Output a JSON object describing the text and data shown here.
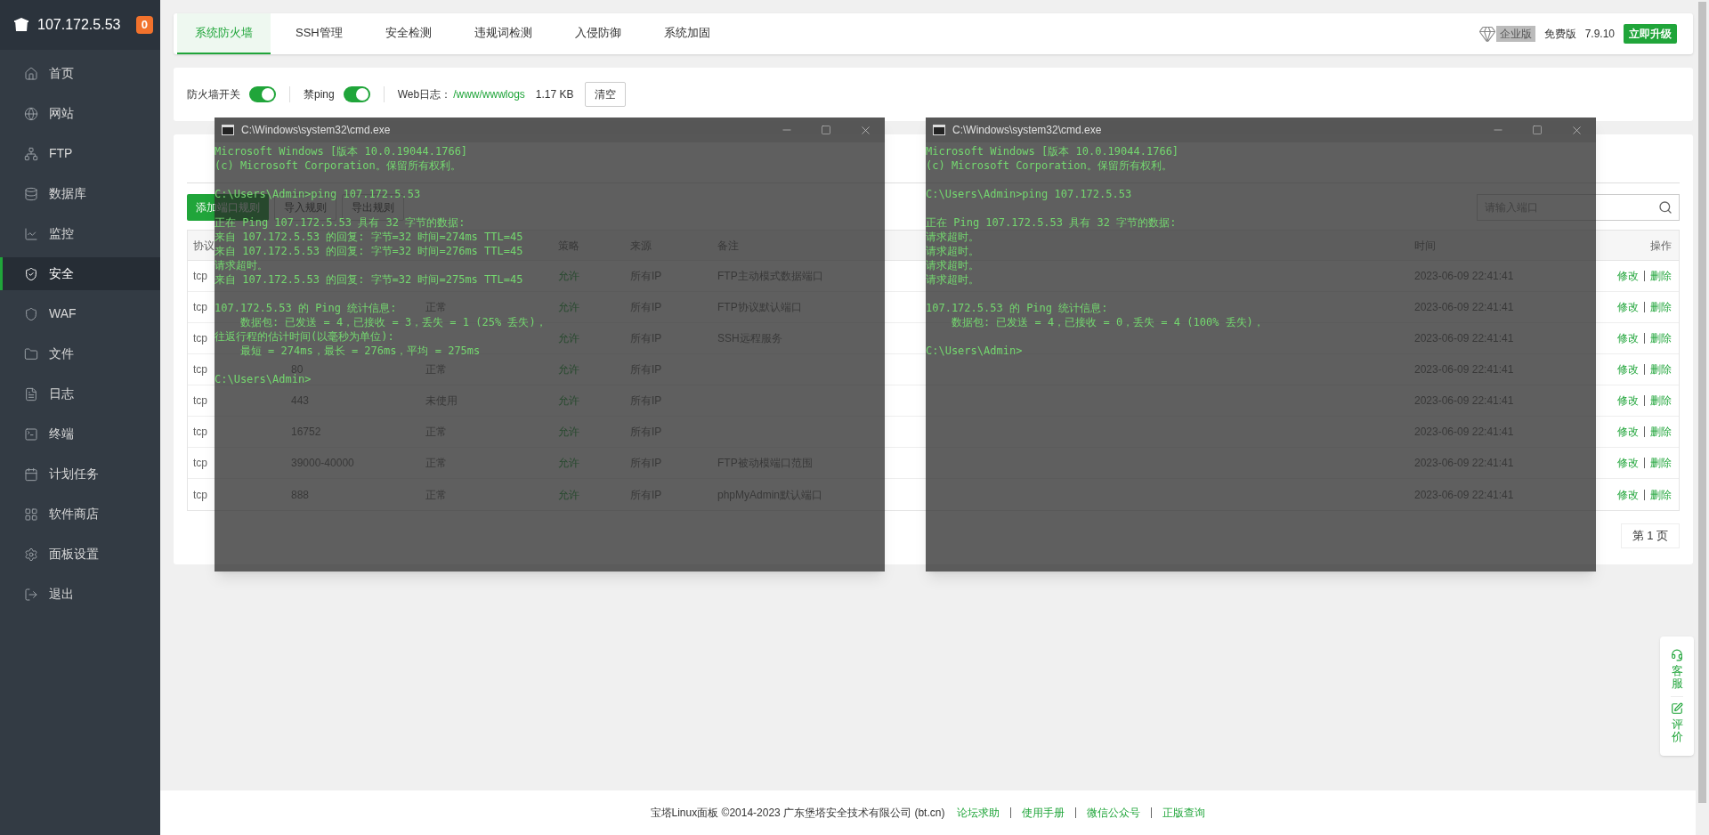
{
  "sidebar": {
    "host": "107.172.5.53",
    "badge": "0",
    "items": [
      {
        "label": "首页",
        "selected": false
      },
      {
        "label": "网站",
        "selected": false
      },
      {
        "label": "FTP",
        "selected": false
      },
      {
        "label": "数据库",
        "selected": false
      },
      {
        "label": "监控",
        "selected": false
      },
      {
        "label": "安全",
        "selected": true
      },
      {
        "label": "WAF",
        "selected": false
      },
      {
        "label": "文件",
        "selected": false
      },
      {
        "label": "日志",
        "selected": false
      },
      {
        "label": "终端",
        "selected": false
      },
      {
        "label": "计划任务",
        "selected": false
      },
      {
        "label": "软件商店",
        "selected": false
      },
      {
        "label": "面板设置",
        "selected": false
      },
      {
        "label": "退出",
        "selected": false
      }
    ]
  },
  "top_tabs": [
    {
      "label": "系统防火墙",
      "selected": true
    },
    {
      "label": "SSH管理",
      "selected": false
    },
    {
      "label": "安全检测",
      "selected": false
    },
    {
      "label": "违规词检测",
      "selected": false
    },
    {
      "label": "入侵防御",
      "selected": false
    },
    {
      "label": "系统加固",
      "selected": false
    }
  ],
  "edition": {
    "badge": "企业版",
    "plan": "免费版",
    "version": "7.9.10",
    "upgrade": "立即升级"
  },
  "settings": {
    "toggles": [
      {
        "label": "防火墙开关",
        "on": true
      },
      {
        "label": "禁ping",
        "on": true
      }
    ],
    "log_label": "Web日志：",
    "log_path": "/www/wwwlogs",
    "log_size": "1.17 KB",
    "clear": "清空"
  },
  "toolbar": {
    "buttons": [
      {
        "label": "添加端口规则",
        "kind": "primary"
      },
      {
        "label": "导入规则",
        "kind": "default"
      },
      {
        "label": "导出规则",
        "kind": "default"
      }
    ],
    "search": {
      "placeholder": "请输入端口"
    }
  },
  "table": {
    "columns": {
      "protocol": "协议",
      "policy": "策略",
      "source": "来源",
      "note": "备注",
      "time": "时间",
      "actions": "操作"
    },
    "rows": [
      {
        "protocol": "tcp",
        "policy": "允许",
        "source": "所有IP",
        "note": "FTP主动模式数据端口",
        "time": "2023-06-09 22:41:41",
        "actions": [
          "修改",
          "删除"
        ]
      },
      {
        "protocol": "tcp",
        "status": "正常",
        "policy": "允许",
        "source": "所有IP",
        "note": "FTP协议默认端口",
        "time": "2023-06-09 22:41:41",
        "actions": [
          "修改",
          "删除"
        ]
      },
      {
        "protocol": "tcp",
        "policy": "允许",
        "source": "所有IP",
        "note": "SSH远程服务",
        "time": "2023-06-09 22:41:41",
        "actions": [
          "修改",
          "删除"
        ]
      },
      {
        "protocol": "tcp",
        "port": "80",
        "status": "正常",
        "policy": "允许",
        "source": "所有IP",
        "time": "2023-06-09 22:41:41",
        "actions": [
          "修改",
          "删除"
        ]
      },
      {
        "protocol": "tcp",
        "port": "443",
        "status": "未使用",
        "policy": "允许",
        "source": "所有IP",
        "time": "2023-06-09 22:41:41",
        "actions": [
          "修改",
          "删除"
        ]
      },
      {
        "protocol": "tcp",
        "port": "16752",
        "status": "正常",
        "policy": "允许",
        "source": "所有IP",
        "time": "2023-06-09 22:41:41",
        "actions": [
          "修改",
          "删除"
        ]
      },
      {
        "protocol": "tcp",
        "port": "39000-40000",
        "status": "正常",
        "policy": "允许",
        "source": "所有IP",
        "note": "FTP被动模端口范围",
        "time": "2023-06-09 22:41:41",
        "actions": [
          "修改",
          "删除"
        ]
      },
      {
        "protocol": "tcp",
        "port": "888",
        "status": "正常",
        "policy": "允许",
        "source": "所有IP",
        "note": "phpMyAdmin默认端口",
        "time": "2023-06-09 22:41:41",
        "actions": [
          "修改",
          "删除"
        ]
      }
    ]
  },
  "pagination": "第 1 页",
  "float_widget": [
    {
      "label": "客服",
      "kind": "service"
    },
    {
      "label": "评价",
      "kind": "review"
    }
  ],
  "footer": {
    "copyright": "宝塔Linux面板 ©2014-2023 广东堡塔安全技术有限公司 (bt.cn)",
    "links": [
      "论坛求助",
      "使用手册",
      "微信公众号",
      "正版查询"
    ]
  },
  "consoles": [
    {
      "title": "C:\\Windows\\system32\\cmd.exe",
      "blocks": [
        [
          "Microsoft Windows [版本 10.0.19044.1766]",
          "(c) Microsoft Corporation。保留所有权利。"
        ],
        [
          "C:\\Users\\Admin>ping 107.172.5.53"
        ],
        [
          "正在 Ping 107.172.5.53 具有 32 字节的数据:",
          "来自 107.172.5.53 的回复: 字节=32 时间=274ms TTL=45",
          "来自 107.172.5.53 的回复: 字节=32 时间=276ms TTL=45",
          "请求超时。",
          "来自 107.172.5.53 的回复: 字节=32 时间=275ms TTL=45"
        ],
        [
          "107.172.5.53 的 Ping 统计信息:",
          "    数据包: 已发送 = 4，已接收 = 3，丢失 = 1 (25% 丢失)，",
          "往返行程的估计时间(以毫秒为单位):",
          "    最短 = 274ms，最长 = 276ms，平均 = 275ms"
        ],
        [
          "C:\\Users\\Admin>"
        ]
      ]
    },
    {
      "title": "C:\\Windows\\system32\\cmd.exe",
      "blocks": [
        [
          "Microsoft Windows [版本 10.0.19044.1766]",
          "(c) Microsoft Corporation。保留所有权利。"
        ],
        [
          "C:\\Users\\Admin>ping 107.172.5.53"
        ],
        [
          "正在 Ping 107.172.5.53 具有 32 字节的数据:",
          "请求超时。",
          "请求超时。",
          "请求超时。",
          "请求超时。"
        ],
        [
          "107.172.5.53 的 Ping 统计信息:",
          "    数据包: 已发送 = 4，已接收 = 0，丢失 = 4 (100% 丢失)，"
        ],
        [
          "C:\\Users\\Admin>"
        ]
      ]
    }
  ]
}
